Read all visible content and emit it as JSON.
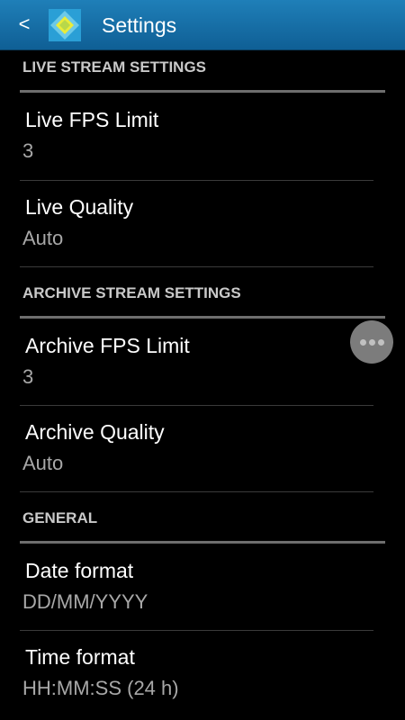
{
  "action_bar": {
    "back_label": "<",
    "title": "Settings",
    "logo_icon": "app-logo-icon",
    "colors": {
      "bar": "#1870aa",
      "logo_outer": "#2a9fd6",
      "logo_inner": "#e9ec3a"
    }
  },
  "sections": [
    {
      "header": "LIVE STREAM SETTINGS",
      "items": [
        {
          "title": "Live FPS Limit",
          "summary": "3"
        },
        {
          "title": "Live Quality",
          "summary": "Auto"
        }
      ]
    },
    {
      "header": "ARCHIVE STREAM SETTINGS",
      "items": [
        {
          "title": "Archive FPS Limit",
          "summary": "3"
        },
        {
          "title": "Archive Quality",
          "summary": "Auto"
        }
      ]
    },
    {
      "header": "GENERAL",
      "items": [
        {
          "title": "Date format",
          "summary": "DD/MM/YYYY"
        },
        {
          "title": "Time format",
          "summary": "HH:MM:SS (24 h)"
        }
      ]
    }
  ],
  "floating_button": {
    "icon": "more-horizontal-icon"
  }
}
